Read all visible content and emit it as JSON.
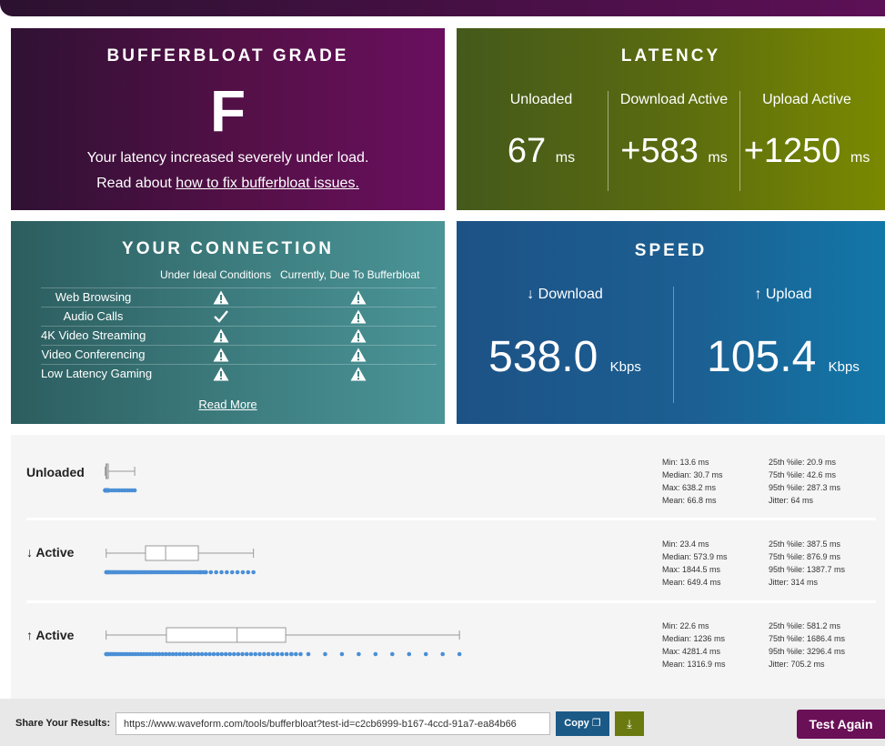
{
  "grade": {
    "title": "BUFFERBLOAT GRADE",
    "letter": "F",
    "message": "Your latency increased severely under load.",
    "read_prefix": "Read about",
    "read_link": "how to fix bufferbloat issues."
  },
  "latency": {
    "title": "LATENCY",
    "unit": "ms",
    "columns": [
      {
        "label": "Unloaded",
        "value": "67"
      },
      {
        "label": "Download Active",
        "value": "+583"
      },
      {
        "label": "Upload Active",
        "value": "+1250"
      }
    ]
  },
  "connection": {
    "title": "YOUR CONNECTION",
    "col_ideal": "Under Ideal Conditions",
    "col_current": "Currently, Due To Bufferbloat",
    "rows": [
      {
        "name": "Web Browsing",
        "ideal": "warning",
        "current": "warning"
      },
      {
        "name": "Audio Calls",
        "ideal": "check",
        "current": "warning"
      },
      {
        "name": "4K Video Streaming",
        "ideal": "warning",
        "current": "warning"
      },
      {
        "name": "Video Conferencing",
        "ideal": "warning",
        "current": "warning"
      },
      {
        "name": "Low Latency Gaming",
        "ideal": "warning",
        "current": "warning"
      }
    ],
    "read_more": "Read More"
  },
  "speed": {
    "title": "SPEED",
    "unit": "Kbps",
    "download_label": "↓ Download",
    "download_value": "538.0",
    "upload_label": "↑ Upload",
    "upload_value": "105.4"
  },
  "stats": [
    {
      "label": "Unloaded",
      "left": [
        "Min: 13.6 ms",
        "Median: 30.7 ms",
        "Max: 638.2 ms",
        "Mean: 66.8 ms"
      ],
      "right": [
        "25th %ile: 20.9 ms",
        "75th %ile: 42.6 ms",
        "95th %ile: 287.3 ms",
        "Jitter: 64 ms"
      ],
      "box": {
        "min": 13.6,
        "q1": 20.9,
        "median": 30.7,
        "q3": 42.6,
        "whisker_high": 287.3
      }
    },
    {
      "label": "↓ Active",
      "left": [
        "Min: 23.4 ms",
        "Median: 573.9 ms",
        "Max: 1844.5 ms",
        "Mean: 649.4 ms"
      ],
      "right": [
        "25th %ile: 387.5 ms",
        "75th %ile: 876.9 ms",
        "95th %ile: 1387.7 ms",
        "Jitter: 314 ms"
      ],
      "box": {
        "min": 23.4,
        "q1": 387.5,
        "median": 573.9,
        "q3": 876.9,
        "whisker_high": 1387.7
      }
    },
    {
      "label": "↑ Active",
      "left": [
        "Min: 22.6 ms",
        "Median: 1236 ms",
        "Max: 4281.4 ms",
        "Mean: 1316.9 ms"
      ],
      "right": [
        "25th %ile: 581.2 ms",
        "75th %ile: 1686.4 ms",
        "95th %ile: 3296.4 ms",
        "Jitter: 705.2 ms"
      ],
      "box": {
        "min": 22.6,
        "q1": 581.2,
        "median": 1236,
        "q3": 1686.4,
        "whisker_high": 3296.4
      }
    }
  ],
  "share": {
    "label": "Share Your Results:",
    "url": "https://www.waveform.com/tools/bufferbloat?test-id=c2cb6999-b167-4ccd-91a7-ea84b66",
    "copy_label": "Copy",
    "again_label": "Test Again"
  },
  "colors": {
    "dot": "#4a8fd6",
    "box_stroke": "#999999"
  }
}
